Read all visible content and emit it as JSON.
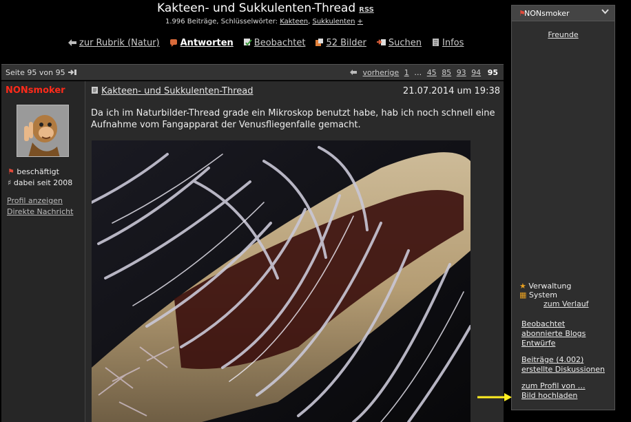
{
  "header": {
    "title": "Kakteen- und Sukkulenten-Thread",
    "rss": "RSS",
    "stats_prefix": "1.996 Beiträge, Schlüsselwörter:",
    "keywords": [
      "Kakteen",
      "Sukkulenten"
    ],
    "keyword_separator": ",",
    "add_keyword": "+"
  },
  "actions": [
    {
      "label": "zur Rubrik (Natur)",
      "icon": "arrow-left-icon"
    },
    {
      "label": "Antworten",
      "icon": "reply-icon"
    },
    {
      "label": "Beobachtet",
      "icon": "watch-icon"
    },
    {
      "label": "52 Bilder",
      "icon": "images-icon"
    },
    {
      "label": "Suchen",
      "icon": "search-icon"
    },
    {
      "label": "Infos",
      "icon": "info-icon"
    }
  ],
  "pagination": {
    "page_info": "Seite 95 von 95",
    "prev_label": "vorherige",
    "pages": [
      "1",
      "…",
      "45",
      "85",
      "93",
      "94"
    ],
    "current": "95"
  },
  "post": {
    "author": "NONsmoker",
    "status": "beschäftigt",
    "member_since": "dabei seit 2008",
    "profile_link": "Profil anzeigen",
    "message_link": "Direkte Nachricht",
    "title": "Kakteen- und Sukkulenten-Thread",
    "date": "21.07.2014 um 19:38",
    "text": "Da ich im Naturbilder-Thread grade ein Mikroskop benutzt habe, hab ich noch schnell eine Aufnahme vom Fangapparat der Venusfliegenfalle gemacht."
  },
  "sidebar": {
    "username": "NONsmoker",
    "friends": "Freunde",
    "admin": "Verwaltung",
    "system": "System",
    "history": "zum Verlauf",
    "group1": [
      "Beobachtet",
      "abonnierte Blogs",
      "Entwürfe"
    ],
    "group2": [
      "Beiträge (4.002)",
      "erstellte Diskussionen"
    ],
    "group3": [
      "zum Profil von …",
      "Bild hochladen"
    ]
  },
  "colors": {
    "author_name": "#ff2a1a",
    "arrow": "#ffee22",
    "background": "#000000",
    "panel": "#2e2e2e"
  }
}
